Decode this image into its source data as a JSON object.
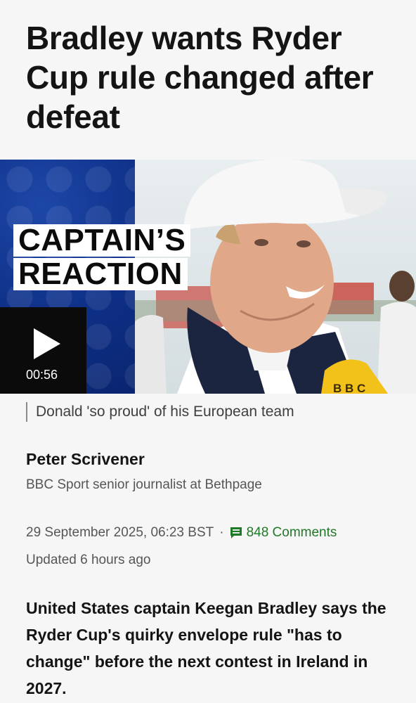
{
  "article": {
    "headline": "Bradley wants Ryder Cup rule changed after defeat",
    "media": {
      "overlay_line1": "CAPTAIN’S",
      "overlay_line2": "REACTION",
      "duration": "00:56",
      "caption": "Donald 'so proud' of his European team",
      "microphone_logo": "BBC"
    },
    "byline": {
      "author": "Peter Scrivener",
      "role": "BBC Sport senior journalist at Bethpage"
    },
    "meta": {
      "date": "29 September 2025, 06:23 BST",
      "separator": "·",
      "comments": "848 Comments",
      "updated": "Updated 6 hours ago"
    },
    "intro": "United States captain Keegan Bradley says the Ryder Cup's quirky envelope rule \"has to change\" before the next contest in Ireland in 2027."
  },
  "colors": {
    "background": "#f6f6f6",
    "comments_green": "#1f7a28",
    "video_blue": "#0e2f86"
  },
  "icons": {
    "play": "play-icon",
    "comments": "comment-icon"
  }
}
